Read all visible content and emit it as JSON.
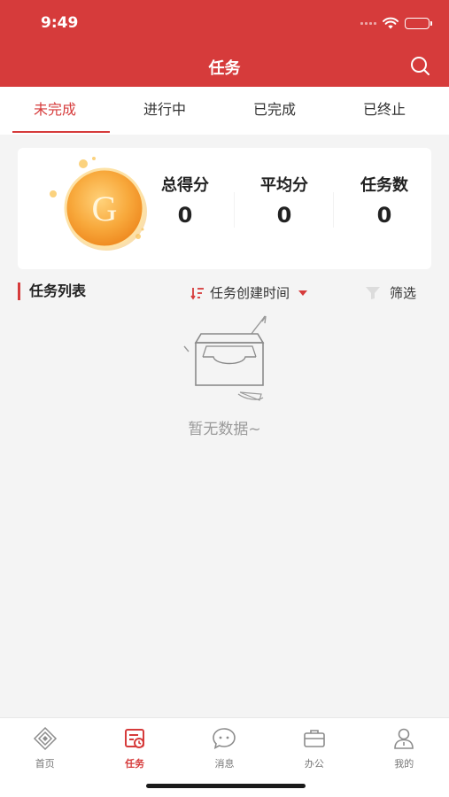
{
  "status_bar": {
    "time": "9:49"
  },
  "header": {
    "title": "任务"
  },
  "tabs": [
    {
      "label": "未完成",
      "active": true
    },
    {
      "label": "进行中",
      "active": false
    },
    {
      "label": "已完成",
      "active": false
    },
    {
      "label": "已终止",
      "active": false
    }
  ],
  "score_card": {
    "coin_letter": "G",
    "stats": [
      {
        "label": "总得分",
        "value": "0"
      },
      {
        "label": "平均分",
        "value": "0"
      },
      {
        "label": "任务数",
        "value": "0"
      }
    ]
  },
  "task_list": {
    "title": "任务列表",
    "sort_label": "任务创建时间",
    "filter_label": "筛选",
    "empty_text": "暂无数据~"
  },
  "tab_bar": [
    {
      "label": "首页",
      "icon": "home-icon",
      "active": false
    },
    {
      "label": "任务",
      "icon": "task-icon",
      "active": true
    },
    {
      "label": "消息",
      "icon": "message-icon",
      "active": false
    },
    {
      "label": "办公",
      "icon": "briefcase-icon",
      "active": false
    },
    {
      "label": "我的",
      "icon": "user-icon",
      "active": false
    }
  ],
  "colors": {
    "brand": "#d63b3b",
    "background": "#f4f4f4",
    "muted_text": "#9a9a9a"
  }
}
